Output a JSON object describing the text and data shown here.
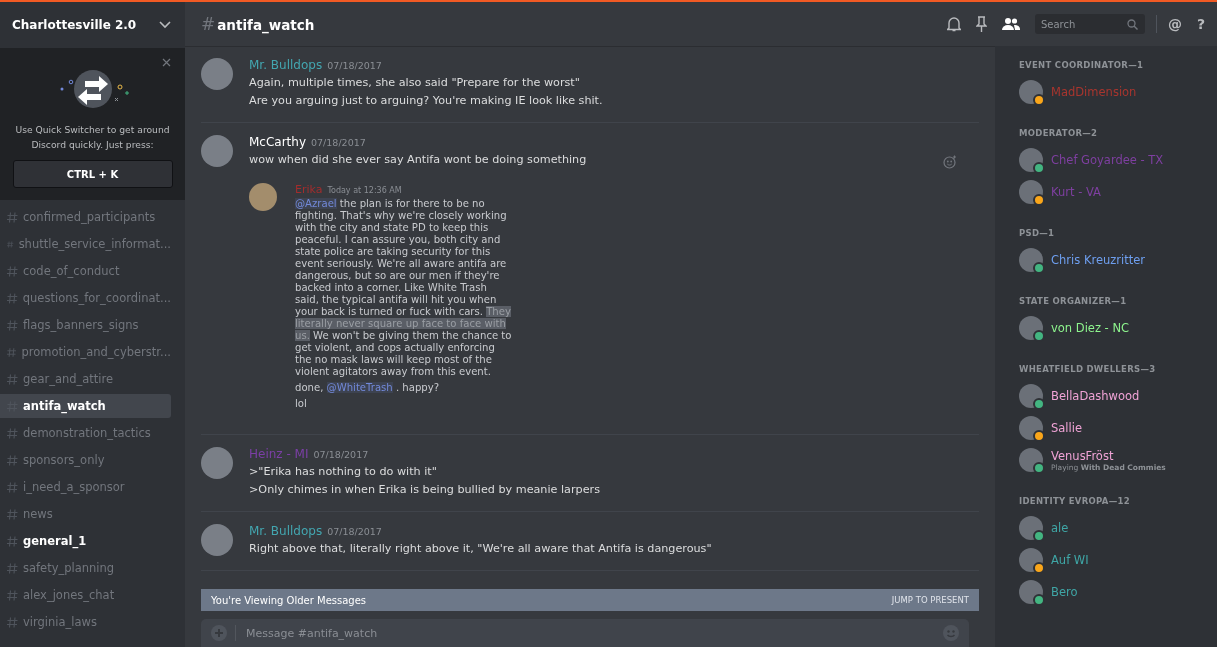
{
  "server": {
    "name": "Charlottesville 2.0"
  },
  "tip": {
    "text": "Use Quick Switcher to get around Discord quickly. Just press:",
    "shortcut": "CTRL + K"
  },
  "channels": [
    {
      "name": "confirmed_participants",
      "selected": false,
      "unread": false
    },
    {
      "name": "shuttle_service_informat...",
      "selected": false,
      "unread": false
    },
    {
      "name": "code_of_conduct",
      "selected": false,
      "unread": false
    },
    {
      "name": "questions_for_coordinat...",
      "selected": false,
      "unread": false
    },
    {
      "name": "flags_banners_signs",
      "selected": false,
      "unread": false
    },
    {
      "name": "promotion_and_cyberstr...",
      "selected": false,
      "unread": false
    },
    {
      "name": "gear_and_attire",
      "selected": false,
      "unread": false
    },
    {
      "name": "antifa_watch",
      "selected": true,
      "unread": true
    },
    {
      "name": "demonstration_tactics",
      "selected": false,
      "unread": false
    },
    {
      "name": "sponsors_only",
      "selected": false,
      "unread": false
    },
    {
      "name": "i_need_a_sponsor",
      "selected": false,
      "unread": false
    },
    {
      "name": "news",
      "selected": false,
      "unread": false
    },
    {
      "name": "general_1",
      "selected": false,
      "unread": true
    },
    {
      "name": "safety_planning",
      "selected": false,
      "unread": false
    },
    {
      "name": "alex_jones_chat",
      "selected": false,
      "unread": false
    },
    {
      "name": "virginia_laws",
      "selected": false,
      "unread": false
    }
  ],
  "header": {
    "hash": "#",
    "channel": "antifa_watch",
    "search": {
      "placeholder": "Search"
    },
    "mention_symbol": "@",
    "help_symbol": "?"
  },
  "messages": [
    {
      "author": "Mr. Bulldops",
      "color": "#43a6b0",
      "timestamp": "07/18/2017",
      "lines": [
        "Again, multiple times, she also said \"Prepare for the worst\"",
        "Are you arguing just to arguing? You're making IE look like shit."
      ]
    },
    {
      "author": "McCarthy",
      "color": "#ffffff",
      "timestamp": "07/18/2017",
      "lines": [
        "wow when did she ever say Antifa wont be doing something"
      ],
      "embed": {
        "author": "Erika",
        "color": "#a12d2d",
        "timestamp": "Today at 12:36 AM",
        "paragraphs": [
          [
            {
              "kind": "mention",
              "text": "@Azrael"
            },
            {
              "kind": "text",
              "text": " the plan is for there to be no fighting. That's why we're closely working with the city and state PD to keep this peaceful. I can assure you, both city and state police are taking security for this event seriously. We're all aware antifa are dangerous, but so are our men if they're backed into a corner. Like White Trash said, the typical antifa will hit you when your back is turned or fuck with cars. "
            },
            {
              "kind": "highlight",
              "text": "They literally never square up face to face with us."
            },
            {
              "kind": "text",
              "text": " We won't be giving them the chance to get violent, and cops actually enforcing the no mask laws will keep most of the violent agitators away from this event."
            }
          ],
          [
            {
              "kind": "text",
              "text": "done, "
            },
            {
              "kind": "mention",
              "text": "@WhiteTrash"
            },
            {
              "kind": "text",
              "text": " . happy?"
            }
          ],
          [
            {
              "kind": "text",
              "text": "lol"
            }
          ]
        ]
      }
    },
    {
      "author": "Heinz - MI",
      "color": "#7b3fa6",
      "timestamp": "07/18/2017",
      "lines": [
        ">\"Erika has nothing to do with it\"",
        ">Only chimes in when Erika is being bullied by meanie larpers"
      ]
    },
    {
      "author": "Mr. Bulldops",
      "color": "#43a6b0",
      "timestamp": "07/18/2017",
      "lines": [
        "Right above that, literally right above it, \"We're all aware that Antifa is dangerous\""
      ]
    }
  ],
  "older_bar": {
    "text": "You're Viewing Older Messages",
    "action": "JUMP TO PRESENT"
  },
  "composer": {
    "placeholder": "Message #antifa_watch"
  },
  "member_groups": [
    {
      "title": "EVENT COORDINATOR—1",
      "members": [
        {
          "name": "MadDimension",
          "color": "#a8352e",
          "idle": true
        }
      ]
    },
    {
      "title": "MODERATOR—2",
      "members": [
        {
          "name": "Chef Goyardee - TX",
          "color": "#7e3fa0",
          "idle": false
        },
        {
          "name": "Kurt - VA",
          "color": "#7e3fa0",
          "idle": true
        }
      ]
    },
    {
      "title": "PSD—1",
      "members": [
        {
          "name": "Chris Kreuzritter",
          "color": "#6e9ff0",
          "idle": false
        }
      ]
    },
    {
      "title": "STATE ORGANIZER—1",
      "members": [
        {
          "name": "von Diez - NC",
          "color": "#8ef58e",
          "idle": false
        }
      ]
    },
    {
      "title": "WHEATFIELD DWELLERS—3",
      "members": [
        {
          "name": "BellaDashwood",
          "color": "#f0a3d6",
          "idle": false
        },
        {
          "name": "Sallie",
          "color": "#f0a3d6",
          "idle": true
        },
        {
          "name": "VenusFröst",
          "color": "#f0a3d6",
          "idle": false,
          "activity": "Playing **With Dead Commies**"
        }
      ]
    },
    {
      "title": "IDENTITY EVROPA—12",
      "members": [
        {
          "name": "ale",
          "color": "#3fa6a6",
          "idle": false
        },
        {
          "name": "Auf WI",
          "color": "#3fa6a6",
          "idle": true
        },
        {
          "name": "Bero",
          "color": "#3fa6a6",
          "idle": false
        }
      ]
    }
  ]
}
